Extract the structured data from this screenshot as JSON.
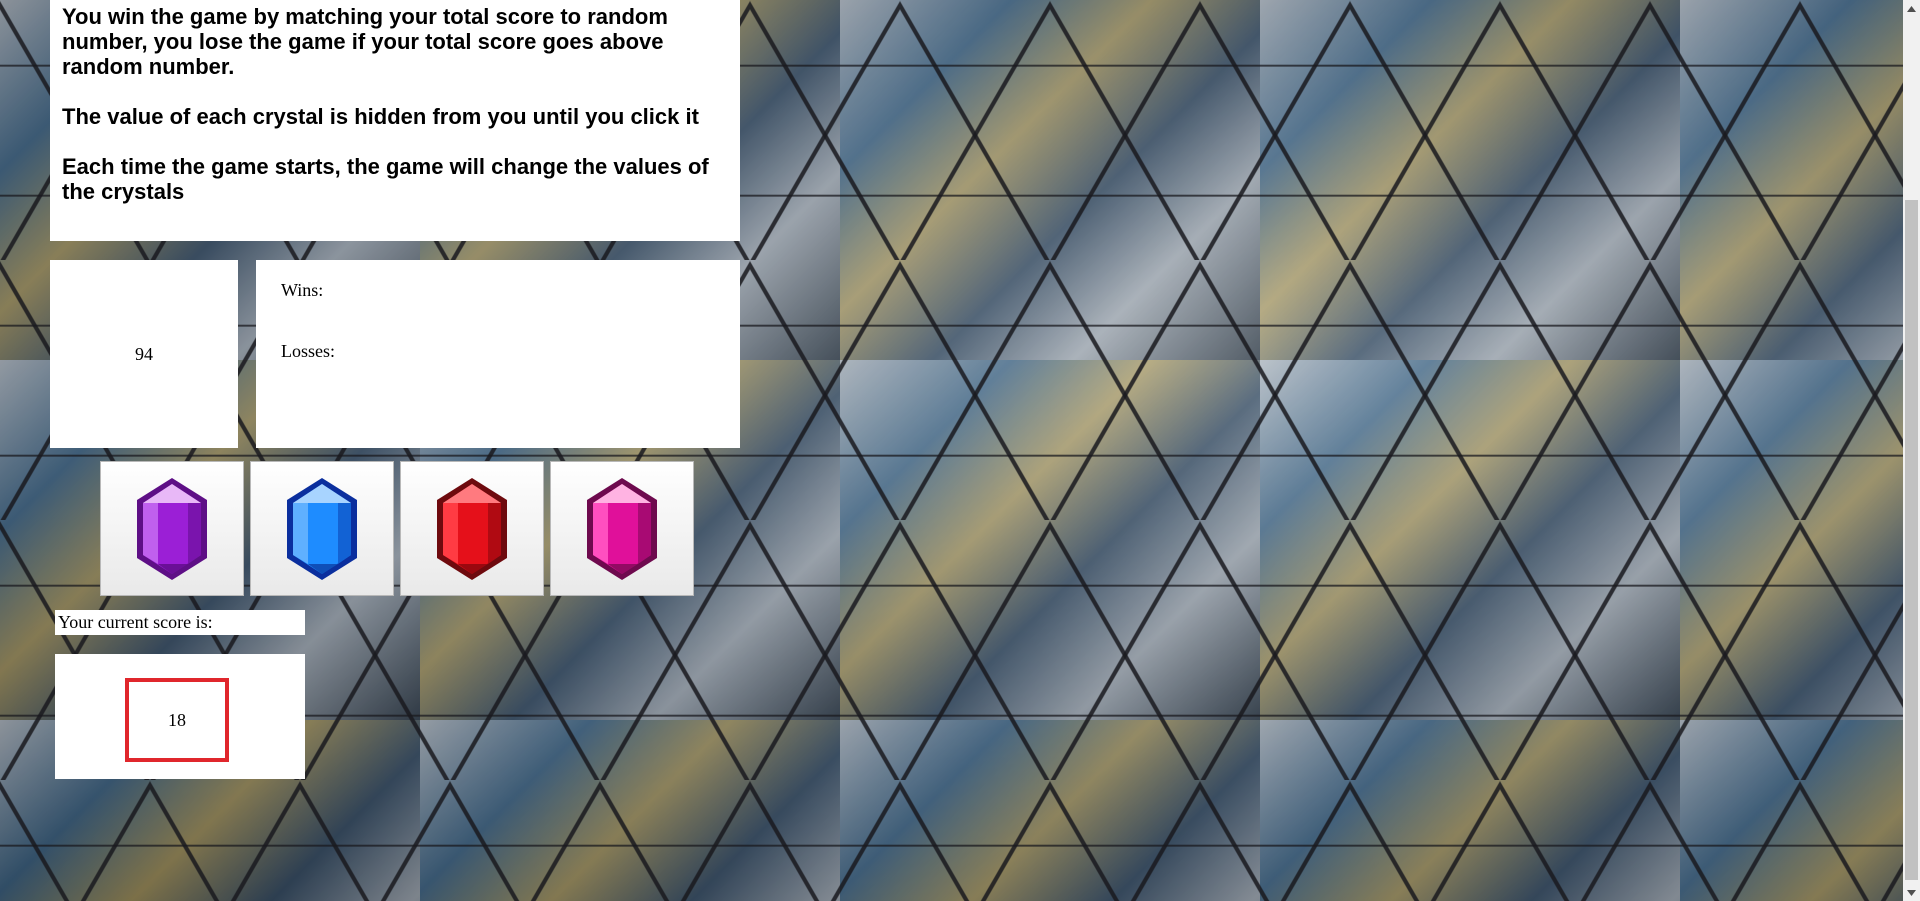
{
  "instructions": {
    "paragraphs": [
      "You win the game by matching your total score to random number, you lose the game if your total score goes above random number.",
      "The value of each crystal is hidden from you until you click it",
      "Each time the game starts, the game will change the values of the crystals"
    ]
  },
  "game": {
    "random_number": "94",
    "wins_label": "Wins:",
    "losses_label": "Losses:",
    "score_label": "Your current score is:",
    "current_score": "18"
  },
  "crystals": [
    {
      "name": "purple-crystal-icon",
      "color": "#9b1fd6"
    },
    {
      "name": "blue-crystal-icon",
      "color": "#1e8cff"
    },
    {
      "name": "red-crystal-icon",
      "color": "#e5101a"
    },
    {
      "name": "magenta-crystal-icon",
      "color": "#e0109a"
    }
  ],
  "colors": {
    "score_highlight": "#e0262c",
    "panel_background": "#ffffff"
  }
}
